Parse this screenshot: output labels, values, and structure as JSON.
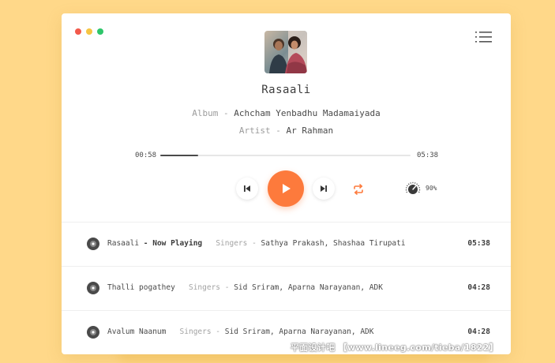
{
  "colors": {
    "background": "#ffd889",
    "accent": "#fd7a3c",
    "window_dots": [
      "#f2594b",
      "#f6c543",
      "#2ec66a"
    ]
  },
  "header": {
    "menu_icon": "list-menu-icon"
  },
  "now_playing": {
    "title": "Rasaali",
    "album_label": "Album -",
    "album": "Achcham Yenbadhu Madamaiyada",
    "artist_label": "Artist -",
    "artist": "Ar Rahman",
    "cover_icon": "album-cover-image"
  },
  "progress": {
    "current": "00:58",
    "total": "05:38",
    "fraction": 0.15
  },
  "controls": {
    "prev_icon": "skip-previous-icon",
    "play_icon": "play-icon",
    "next_icon": "skip-next-icon",
    "repeat_icon": "repeat-icon",
    "volume_icon": "volume-knob-icon",
    "volume": "90%"
  },
  "tracks": [
    {
      "title": "Rasaali",
      "status": "Now Playing",
      "singers_label": "Singers -",
      "singers": "Sathya Prakash, Shashaa Tirupati",
      "duration": "05:38"
    },
    {
      "title": "Thalli pogathey",
      "singers_label": "Singers -",
      "singers": "Sid Sriram, Aparna Narayanan, ADK",
      "duration": "04:28"
    },
    {
      "title": "Avalum Naanum",
      "singers_label": "Singers -",
      "singers": "Sid Sriram, Aparna Narayanan, ADK",
      "duration": "04:28"
    }
  ],
  "watermark": "平面设计吧 【www.lineeg.com/tieba/1822】"
}
